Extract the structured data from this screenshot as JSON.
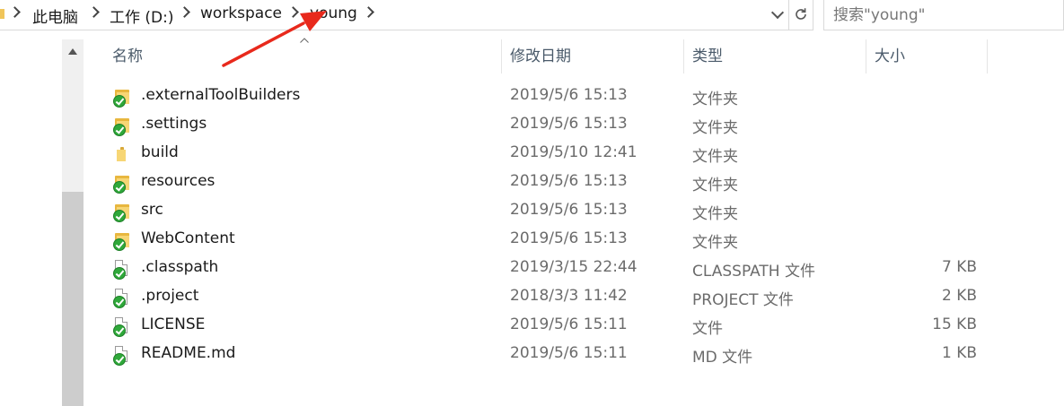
{
  "breadcrumb": {
    "items": [
      "此电脑",
      "工作 (D:)",
      "workspace",
      "young"
    ]
  },
  "search": {
    "placeholder": "搜索\"young\""
  },
  "columns": {
    "name": "名称",
    "modified": "修改日期",
    "type": "类型",
    "size": "大小"
  },
  "files": [
    {
      "name": ".externalToolBuilders",
      "date": "2019/5/6 15:13",
      "type": "文件夹",
      "size": "",
      "icon": "folder-synced"
    },
    {
      "name": ".settings",
      "date": "2019/5/6 15:13",
      "type": "文件夹",
      "size": "",
      "icon": "folder-synced"
    },
    {
      "name": "build",
      "date": "2019/5/10 12:41",
      "type": "文件夹",
      "size": "",
      "icon": "folder"
    },
    {
      "name": "resources",
      "date": "2019/5/6 15:13",
      "type": "文件夹",
      "size": "",
      "icon": "folder-synced"
    },
    {
      "name": "src",
      "date": "2019/5/6 15:13",
      "type": "文件夹",
      "size": "",
      "icon": "folder-synced"
    },
    {
      "name": "WebContent",
      "date": "2019/5/6 15:13",
      "type": "文件夹",
      "size": "",
      "icon": "folder-synced"
    },
    {
      "name": ".classpath",
      "date": "2019/3/15 22:44",
      "type": "CLASSPATH 文件",
      "size": "7 KB",
      "icon": "file-synced"
    },
    {
      "name": ".project",
      "date": "2018/3/3 11:42",
      "type": "PROJECT 文件",
      "size": "2 KB",
      "icon": "file-synced"
    },
    {
      "name": "LICENSE",
      "date": "2019/5/6 15:11",
      "type": "文件",
      "size": "15 KB",
      "icon": "file-synced"
    },
    {
      "name": "README.md",
      "date": "2019/5/6 15:11",
      "type": "MD 文件",
      "size": "1 KB",
      "icon": "file-synced"
    }
  ],
  "colors": {
    "annotation_arrow": "#e8291c",
    "sync_check": "#2fa83a",
    "folder": "#f7d675"
  }
}
